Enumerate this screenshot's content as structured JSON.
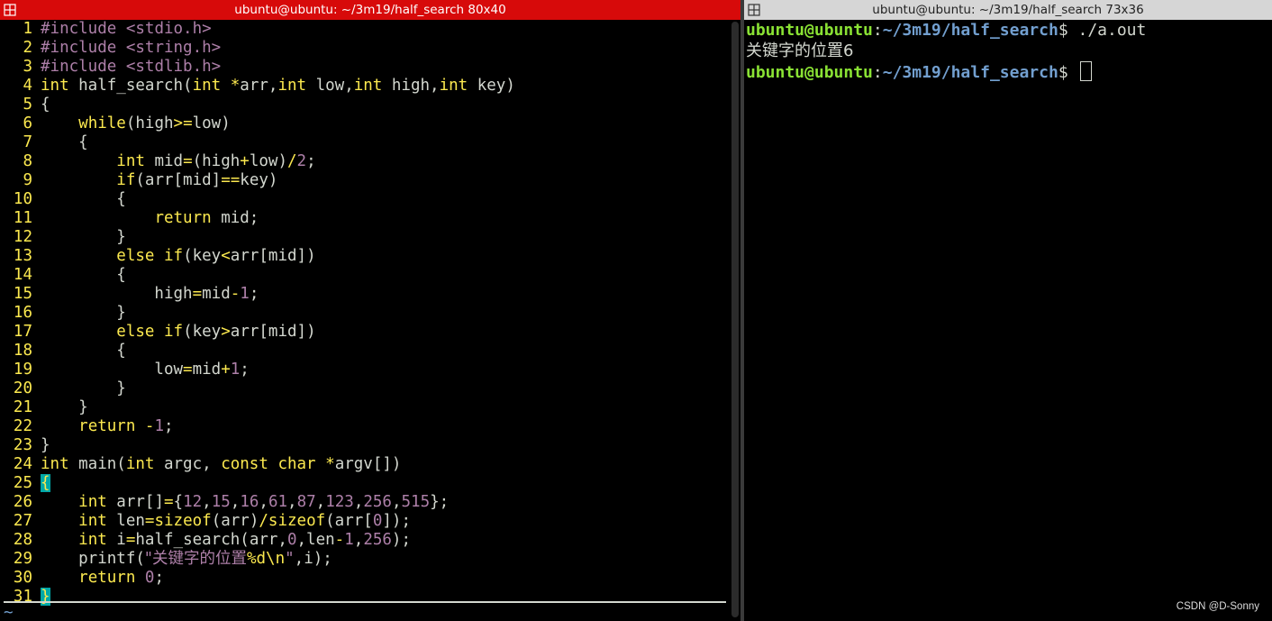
{
  "left_window": {
    "title": "ubuntu@ubuntu: ~/3m19/half_search 80x40",
    "icon": "terminal-split-icon",
    "accent_color": "#d70a0a"
  },
  "right_window": {
    "title": "ubuntu@ubuntu: ~/3m19/half_search 73x36",
    "icon": "terminal-split-icon"
  },
  "editor": {
    "lines": [
      {
        "n": "1",
        "t": [
          [
            "pp",
            "#include"
          ],
          [
            "id",
            " "
          ],
          [
            "pp",
            "<stdio.h>"
          ]
        ]
      },
      {
        "n": "2",
        "t": [
          [
            "pp",
            "#include"
          ],
          [
            "id",
            " "
          ],
          [
            "pp",
            "<string.h>"
          ]
        ]
      },
      {
        "n": "3",
        "t": [
          [
            "pp",
            "#include"
          ],
          [
            "id",
            " "
          ],
          [
            "pp",
            "<stdlib.h>"
          ]
        ]
      },
      {
        "n": "4",
        "t": [
          [
            "kw",
            "int"
          ],
          [
            "id",
            " half_search("
          ],
          [
            "kw",
            "int"
          ],
          [
            "id",
            " "
          ],
          [
            "op",
            "*"
          ],
          [
            "id",
            "arr,"
          ],
          [
            "kw",
            "int"
          ],
          [
            "id",
            " low,"
          ],
          [
            "kw",
            "int"
          ],
          [
            "id",
            " high,"
          ],
          [
            "kw",
            "int"
          ],
          [
            "id",
            " key)"
          ]
        ]
      },
      {
        "n": "5",
        "t": [
          [
            "id",
            "{"
          ]
        ]
      },
      {
        "n": "6",
        "t": [
          [
            "id",
            "    "
          ],
          [
            "kw",
            "while"
          ],
          [
            "id",
            "(high"
          ],
          [
            "op",
            ">="
          ],
          [
            "id",
            "low)"
          ]
        ]
      },
      {
        "n": "7",
        "t": [
          [
            "id",
            "    {"
          ]
        ]
      },
      {
        "n": "8",
        "t": [
          [
            "id",
            "        "
          ],
          [
            "kw",
            "int"
          ],
          [
            "id",
            " mid"
          ],
          [
            "op",
            "="
          ],
          [
            "id",
            "(high"
          ],
          [
            "op",
            "+"
          ],
          [
            "id",
            "low)"
          ],
          [
            "op",
            "/"
          ],
          [
            "num",
            "2"
          ],
          [
            "id",
            ";"
          ]
        ]
      },
      {
        "n": "9",
        "t": [
          [
            "id",
            "        "
          ],
          [
            "kw",
            "if"
          ],
          [
            "id",
            "(arr[mid]"
          ],
          [
            "op",
            "=="
          ],
          [
            "id",
            "key)"
          ]
        ]
      },
      {
        "n": "10",
        "t": [
          [
            "id",
            "        {"
          ]
        ]
      },
      {
        "n": "11",
        "t": [
          [
            "id",
            "            "
          ],
          [
            "kw",
            "return"
          ],
          [
            "id",
            " mid;"
          ]
        ]
      },
      {
        "n": "12",
        "t": [
          [
            "id",
            "        }"
          ]
        ]
      },
      {
        "n": "13",
        "t": [
          [
            "id",
            "        "
          ],
          [
            "kw",
            "else"
          ],
          [
            "id",
            " "
          ],
          [
            "kw",
            "if"
          ],
          [
            "id",
            "(key"
          ],
          [
            "op",
            "<"
          ],
          [
            "id",
            "arr[mid])"
          ]
        ]
      },
      {
        "n": "14",
        "t": [
          [
            "id",
            "        {"
          ]
        ]
      },
      {
        "n": "15",
        "t": [
          [
            "id",
            "            high"
          ],
          [
            "op",
            "="
          ],
          [
            "id",
            "mid"
          ],
          [
            "op",
            "-"
          ],
          [
            "num",
            "1"
          ],
          [
            "id",
            ";"
          ]
        ]
      },
      {
        "n": "16",
        "t": [
          [
            "id",
            "        }"
          ]
        ]
      },
      {
        "n": "17",
        "t": [
          [
            "id",
            "        "
          ],
          [
            "kw",
            "else"
          ],
          [
            "id",
            " "
          ],
          [
            "kw",
            "if"
          ],
          [
            "id",
            "(key"
          ],
          [
            "op",
            ">"
          ],
          [
            "id",
            "arr[mid])"
          ]
        ]
      },
      {
        "n": "18",
        "t": [
          [
            "id",
            "        {"
          ]
        ]
      },
      {
        "n": "19",
        "t": [
          [
            "id",
            "            low"
          ],
          [
            "op",
            "="
          ],
          [
            "id",
            "mid"
          ],
          [
            "op",
            "+"
          ],
          [
            "num",
            "1"
          ],
          [
            "id",
            ";"
          ]
        ]
      },
      {
        "n": "20",
        "t": [
          [
            "id",
            "        }"
          ]
        ]
      },
      {
        "n": "21",
        "t": [
          [
            "id",
            "    }"
          ]
        ]
      },
      {
        "n": "22",
        "t": [
          [
            "id",
            "    "
          ],
          [
            "kw",
            "return"
          ],
          [
            "id",
            " "
          ],
          [
            "op",
            "-"
          ],
          [
            "num",
            "1"
          ],
          [
            "id",
            ";"
          ]
        ]
      },
      {
        "n": "23",
        "t": [
          [
            "id",
            "}"
          ]
        ]
      },
      {
        "n": "24",
        "t": [
          [
            "kw",
            "int"
          ],
          [
            "id",
            " main("
          ],
          [
            "kw",
            "int"
          ],
          [
            "id",
            " argc, "
          ],
          [
            "kw",
            "const"
          ],
          [
            "id",
            " "
          ],
          [
            "kw",
            "char"
          ],
          [
            "id",
            " "
          ],
          [
            "op",
            "*"
          ],
          [
            "id",
            "argv[])"
          ]
        ]
      },
      {
        "n": "25",
        "t": [
          [
            "cur",
            "{"
          ]
        ]
      },
      {
        "n": "26",
        "t": [
          [
            "id",
            "    "
          ],
          [
            "kw",
            "int"
          ],
          [
            "id",
            " arr[]"
          ],
          [
            "op",
            "="
          ],
          [
            "id",
            "{"
          ],
          [
            "num",
            "12"
          ],
          [
            "id",
            ","
          ],
          [
            "num",
            "15"
          ],
          [
            "id",
            ","
          ],
          [
            "num",
            "16"
          ],
          [
            "id",
            ","
          ],
          [
            "num",
            "61"
          ],
          [
            "id",
            ","
          ],
          [
            "num",
            "87"
          ],
          [
            "id",
            ","
          ],
          [
            "num",
            "123"
          ],
          [
            "id",
            ","
          ],
          [
            "num",
            "256"
          ],
          [
            "id",
            ","
          ],
          [
            "num",
            "515"
          ],
          [
            "id",
            "};"
          ]
        ]
      },
      {
        "n": "27",
        "t": [
          [
            "id",
            "    "
          ],
          [
            "kw",
            "int"
          ],
          [
            "id",
            " len"
          ],
          [
            "op",
            "="
          ],
          [
            "kw",
            "sizeof"
          ],
          [
            "id",
            "(arr)"
          ],
          [
            "op",
            "/"
          ],
          [
            "kw",
            "sizeof"
          ],
          [
            "id",
            "(arr["
          ],
          [
            "num",
            "0"
          ],
          [
            "id",
            "]);"
          ]
        ]
      },
      {
        "n": "28",
        "t": [
          [
            "id",
            "    "
          ],
          [
            "kw",
            "int"
          ],
          [
            "id",
            " i"
          ],
          [
            "op",
            "="
          ],
          [
            "id",
            "half_search(arr,"
          ],
          [
            "num",
            "0"
          ],
          [
            "id",
            ",len"
          ],
          [
            "op",
            "-"
          ],
          [
            "num",
            "1"
          ],
          [
            "id",
            ","
          ],
          [
            "num",
            "256"
          ],
          [
            "id",
            ");"
          ]
        ]
      },
      {
        "n": "29",
        "t": [
          [
            "id",
            "    printf("
          ],
          [
            "str",
            "\"关键字的位置"
          ],
          [
            "kw",
            "%d\\n"
          ],
          [
            "str",
            "\""
          ],
          [
            "id",
            ",i);"
          ]
        ]
      },
      {
        "n": "30",
        "t": [
          [
            "id",
            "    "
          ],
          [
            "kw",
            "return"
          ],
          [
            "id",
            " "
          ],
          [
            "num",
            "0"
          ],
          [
            "id",
            ";"
          ]
        ]
      },
      {
        "n": "31",
        "t": [
          [
            "cur",
            "}"
          ]
        ]
      }
    ],
    "tilde": "~"
  },
  "terminal": {
    "prompt_user": "ubuntu@ubuntu",
    "prompt_path": "~/3m19/half_search",
    "prompt_sep": ":",
    "prompt_dollar": "$ ",
    "command": "./a.out",
    "output": "关键字的位置6"
  },
  "watermark": "CSDN @D-Sonny"
}
